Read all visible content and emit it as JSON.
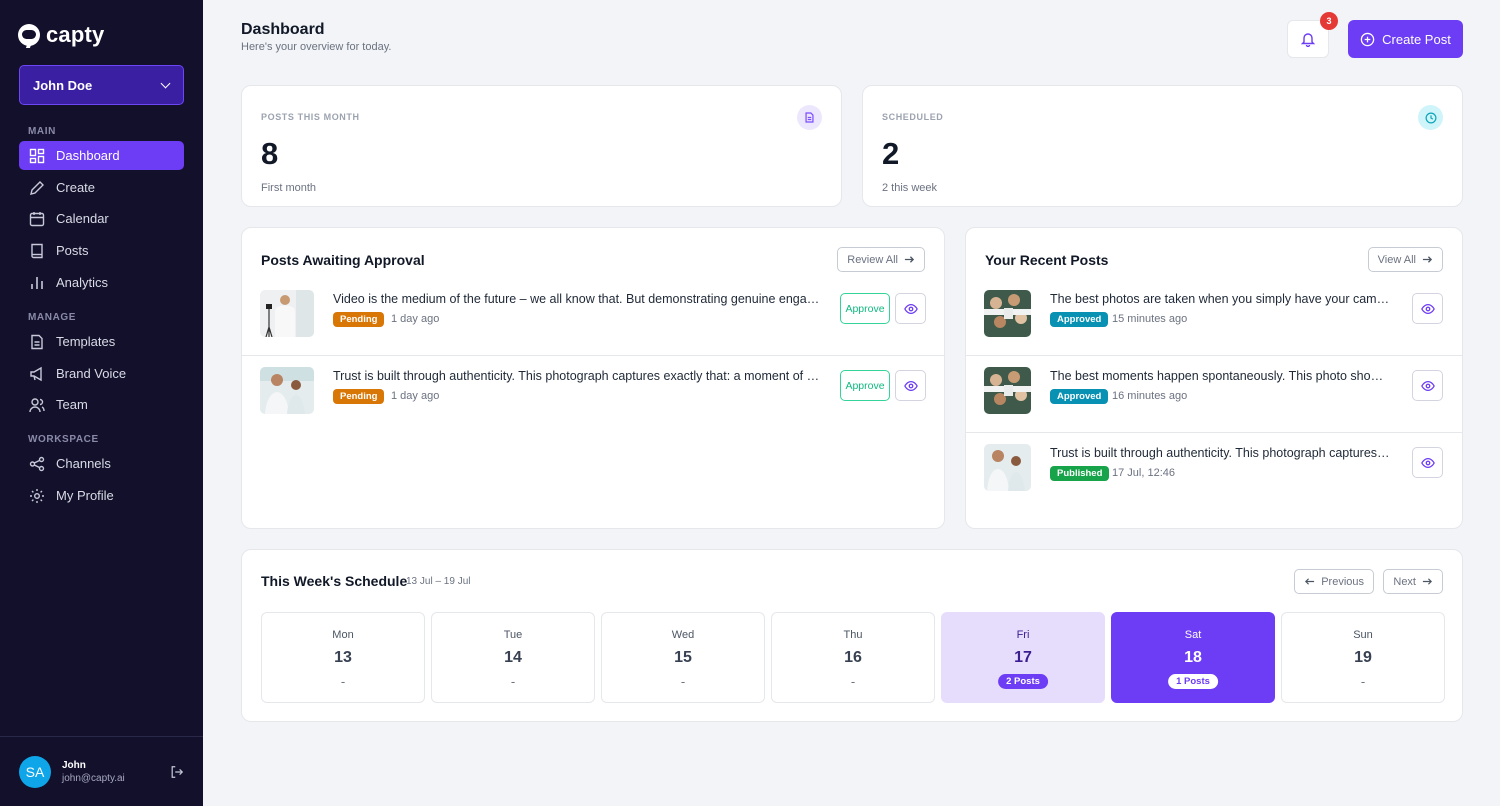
{
  "app": {
    "brand": "capty"
  },
  "account": {
    "name": "John Doe"
  },
  "sidebar": {
    "sections": [
      {
        "label": "MAIN",
        "items": [
          {
            "label": "Dashboard",
            "icon": "dashboard-icon",
            "active": true
          },
          {
            "label": "Create",
            "icon": "pencil-icon"
          },
          {
            "label": "Calendar",
            "icon": "calendar-icon"
          },
          {
            "label": "Posts",
            "icon": "book-icon"
          },
          {
            "label": "Analytics",
            "icon": "bar-chart-icon"
          }
        ]
      },
      {
        "label": "MANAGE",
        "items": [
          {
            "label": "Templates",
            "icon": "document-icon"
          },
          {
            "label": "Brand Voice",
            "icon": "megaphone-icon"
          },
          {
            "label": "Team",
            "icon": "users-icon"
          }
        ]
      },
      {
        "label": "WORKSPACE",
        "items": [
          {
            "label": "Channels",
            "icon": "share-icon"
          },
          {
            "label": "My Profile",
            "icon": "gear-icon"
          }
        ]
      }
    ]
  },
  "user": {
    "initials": "SA",
    "name": "John",
    "email": "john@capty.ai"
  },
  "header": {
    "title": "Dashboard",
    "subtitle": "Here's your overview for today.",
    "notification_count": "3",
    "create_label": "Create Post"
  },
  "stats": [
    {
      "label": "POSTS THIS MONTH",
      "value": "8",
      "sub": "First month",
      "icon": "document-icon",
      "icon_bg": "#ede7fe",
      "icon_color": "#7c4dff"
    },
    {
      "label": "SCHEDULED",
      "value": "2",
      "sub": "2 this week",
      "icon": "clock-icon",
      "icon_bg": "#cff4fa",
      "icon_color": "#0ea5b7"
    }
  ],
  "approval": {
    "title": "Posts Awaiting Approval",
    "action_label": "Review All",
    "approve_label": "Approve",
    "items": [
      {
        "text": "Video is the medium of the future – we all know that. But demonstrating genuine engagement and connection",
        "status": "Pending",
        "time": "1 day ago"
      },
      {
        "text": "Trust is built through authenticity. This photograph captures exactly that: a moment of genuine connection",
        "status": "Pending",
        "time": "1 day ago"
      }
    ]
  },
  "recent": {
    "title": "Your Recent Posts",
    "action_label": "View All",
    "items": [
      {
        "text": "The best photos are taken when you simply have your camera ready",
        "status": "Approved",
        "time": "15 minutes ago"
      },
      {
        "text": "The best moments happen spontaneously. This photo shows exactly that",
        "status": "Approved",
        "time": "16 minutes ago"
      },
      {
        "text": "Trust is built through authenticity. This photograph captures exactly that",
        "status": "Published",
        "time": "17 Jul, 12:46"
      }
    ]
  },
  "schedule": {
    "title": "This Week's Schedule",
    "range": "13 Jul – 19 Jul",
    "prev_label": "Previous",
    "next_label": "Next",
    "days": [
      {
        "name": "Mon",
        "num": "13",
        "info": "-"
      },
      {
        "name": "Tue",
        "num": "14",
        "info": "-"
      },
      {
        "name": "Wed",
        "num": "15",
        "info": "-"
      },
      {
        "name": "Thu",
        "num": "16",
        "info": "-"
      },
      {
        "name": "Fri",
        "num": "17",
        "info": "2 Posts"
      },
      {
        "name": "Sat",
        "num": "18",
        "info": "1 Posts"
      },
      {
        "name": "Sun",
        "num": "19",
        "info": "-"
      }
    ]
  },
  "colors": {
    "accent": "#6d3cf5",
    "sidebar_bg": "#12102b",
    "pending": "#d97706",
    "approved": "#0891b2",
    "published": "#16a34a"
  }
}
